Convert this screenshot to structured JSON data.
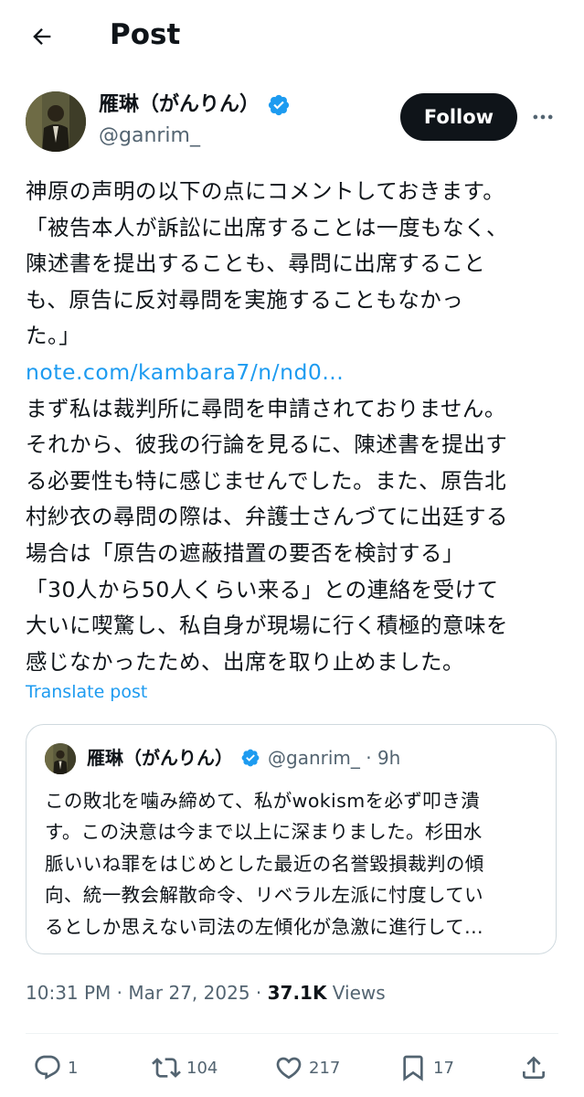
{
  "header": {
    "title": "Post",
    "back_icon": "arrow-left-icon"
  },
  "author": {
    "display_name": "雁琳（がんりん）",
    "handle": "@ganrim_",
    "verified": true,
    "follow_label": "Follow",
    "more_icon": "more-horizontal-icon"
  },
  "post": {
    "lines": [
      "神原の声明の以下の点にコメントしておきます。",
      "「被告本人が訴訟に出席することは一度もなく、",
      "陳述書を提出することも、尋問に出席すること",
      "も、原告に反対尋問を実施することもなかっ",
      "た。」"
    ],
    "link_text": "note.com/kambara7/n/nd0...",
    "lines_after": [
      "まず私は裁判所に尋問を申請されておりません。",
      "それから、彼我の行論を見るに、陳述書を提出す",
      "る必要性も特に感じませんでした。また、原告北",
      "村紗衣の尋問の際は、弁護士さんづてに出廷する",
      "場合は「原告の遮蔽措置の要否を検討する」",
      "「30人から50人くらい来る」との連絡を受けて",
      "大いに喫驚し、私自身が現場に行く積極的意味を",
      "感じなかったため、出席を取り止めました。"
    ],
    "translate_label": "Translate post"
  },
  "quote": {
    "display_name": "雁琳（がんりん）",
    "handle_time": "@ganrim_ · 9h",
    "verified": true,
    "lines": [
      "この敗北を噛み締めて、私がwokismを必ず叩き潰",
      "す。この決意は今まで以上に深まりました。杉田水",
      "脈いいね罪をはじめとした最近の名誉毀損裁判の傾",
      "向、統一教会解散命令、リベラル左派に忖度してい",
      "るとしか思えない司法の左傾化が急激に進行して..."
    ]
  },
  "meta": {
    "timestamp": "10:31 PM · Mar 27, 2025 · ",
    "views_count": "37.1K",
    "views_label": " Views"
  },
  "actions": {
    "replies": "1",
    "reposts": "104",
    "likes": "217",
    "bookmarks": "17"
  },
  "colors": {
    "accent": "#1d9bf0",
    "text": "#0f1419",
    "secondary": "#536471",
    "border": "#cfd9de"
  }
}
